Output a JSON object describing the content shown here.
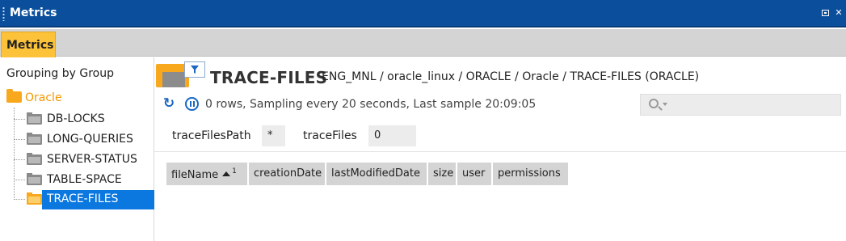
{
  "window": {
    "title": "Metrics"
  },
  "tabs": [
    {
      "label": "Metrics",
      "active": true
    }
  ],
  "sidebar": {
    "heading": "Grouping by Group",
    "root": {
      "label": "Oracle",
      "icon": "folder-icon"
    },
    "items": [
      {
        "label": "DB-LOCKS",
        "icon": "metric-folder-icon",
        "selected": false
      },
      {
        "label": "LONG-QUERIES",
        "icon": "metric-folder-icon",
        "selected": false
      },
      {
        "label": "SERVER-STATUS",
        "icon": "metric-folder-icon",
        "selected": false
      },
      {
        "label": "TABLE-SPACE",
        "icon": "metric-folder-icon",
        "selected": false
      },
      {
        "label": "TRACE-FILES",
        "icon": "metric-folder-icon",
        "selected": true
      }
    ]
  },
  "main": {
    "title": "TRACE-FILES",
    "breadcrumb": "ENG_MNL / oracle_linux / ORACLE / Oracle / TRACE-FILES (ORACLE)",
    "status": "0 rows, Sampling every 20 seconds, Last sample 20:09:05",
    "search": {
      "placeholder": "",
      "value": ""
    },
    "params": [
      {
        "label": "traceFilesPath",
        "value": "*"
      },
      {
        "label": "traceFiles",
        "value": "0"
      }
    ],
    "table": {
      "columns": [
        {
          "label": "fileName",
          "sort_index": "1",
          "sorted": "asc"
        },
        {
          "label": "creationDate"
        },
        {
          "label": "lastModifiedDate"
        },
        {
          "label": "size"
        },
        {
          "label": "user"
        },
        {
          "label": "permissions"
        }
      ],
      "rows": []
    }
  },
  "colors": {
    "title_bar": "#0b4f9c",
    "tab_active": "#fcc23a",
    "selection": "#0b78e0",
    "folder": "#f7a81c",
    "root_label": "#f29700",
    "table_header": "#d4d4d4"
  }
}
